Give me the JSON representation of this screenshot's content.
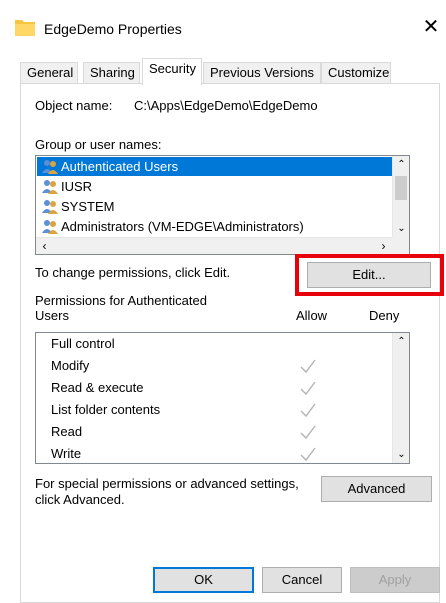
{
  "window": {
    "title": "EdgeDemo Properties",
    "close_glyph": "✕"
  },
  "tabs": [
    {
      "label": "General"
    },
    {
      "label": "Sharing"
    },
    {
      "label": "Security",
      "active": true
    },
    {
      "label": "Previous Versions"
    },
    {
      "label": "Customize"
    }
  ],
  "object": {
    "label": "Object name:",
    "value": "C:\\Apps\\EdgeDemo\\EdgeDemo"
  },
  "groups": {
    "label": "Group or user names:",
    "items": [
      {
        "name": "Authenticated Users",
        "selected": true
      },
      {
        "name": "IUSR"
      },
      {
        "name": "SYSTEM"
      },
      {
        "name": "Administrators (VM-EDGE\\Administrators)"
      }
    ]
  },
  "change": {
    "text": "To change permissions, click Edit.",
    "edit_label": "Edit..."
  },
  "permissions": {
    "header_line1": "Permissions for Authenticated",
    "header_line2": "Users",
    "allow_label": "Allow",
    "deny_label": "Deny",
    "items": [
      {
        "name": "Full control",
        "allow": false
      },
      {
        "name": "Modify",
        "allow": true
      },
      {
        "name": "Read & execute",
        "allow": true
      },
      {
        "name": "List folder contents",
        "allow": true
      },
      {
        "name": "Read",
        "allow": true
      },
      {
        "name": "Write",
        "allow": true
      }
    ]
  },
  "special": {
    "line1": "For special permissions or advanced settings,",
    "line2": "click Advanced.",
    "advanced_label": "Advanced"
  },
  "footer": {
    "ok_label": "OK",
    "cancel_label": "Cancel",
    "apply_label": "Apply"
  },
  "colors": {
    "selection": "#0078d7",
    "highlight_box": "#e8000b",
    "check_gray": "#b4b4b4"
  },
  "icons": {
    "folder": "folder-icon",
    "user_group": "user-group-icon",
    "check": "check-icon"
  }
}
